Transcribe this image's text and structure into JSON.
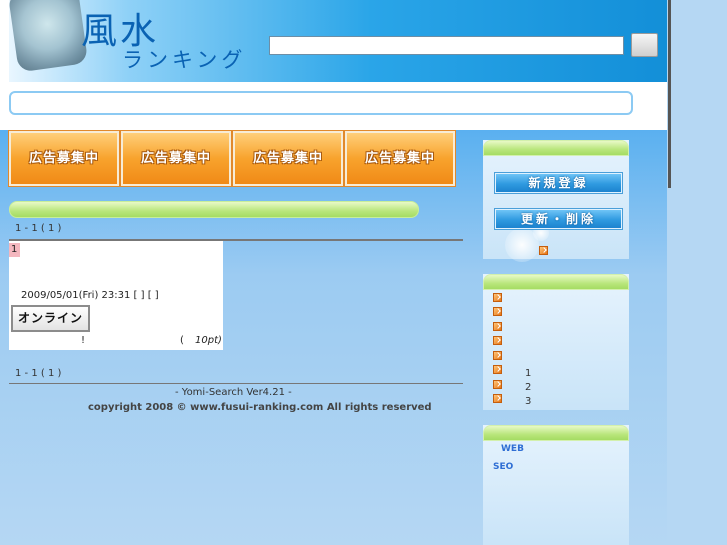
{
  "header": {
    "logo_main": "風水",
    "logo_sub": "ランキング",
    "search_value": "",
    "search_button_label": ""
  },
  "ads": [
    "広告募集中",
    "広告募集中",
    "広告募集中",
    "広告募集中"
  ],
  "pager": {
    "top": "1 - 1 ( 1   )",
    "bottom": "1 - 1 ( 1   )"
  },
  "result": {
    "number": "1",
    "date": "2009/05/01(Fri) 23:31 [     ] [     ]",
    "badge": "オンライン",
    "bang": "!",
    "paren": "(",
    "points": "10pt)"
  },
  "footer": {
    "version": "- Yomi-Search Ver4.21 -",
    "copyright": "copyright 2008 © www.fusui-ranking.com All rights reserved"
  },
  "sidebar": {
    "register_label": "新規登録",
    "update_label": "更新・削除",
    "ranks": [
      "1",
      "2",
      "3"
    ],
    "links": [
      "WEB",
      "SEO"
    ]
  },
  "colors": {
    "header_blue": "#138fd8",
    "ad_orange": "#f08a16",
    "bar_green": "#b9e67c",
    "button_blue": "#2f9ae0"
  }
}
